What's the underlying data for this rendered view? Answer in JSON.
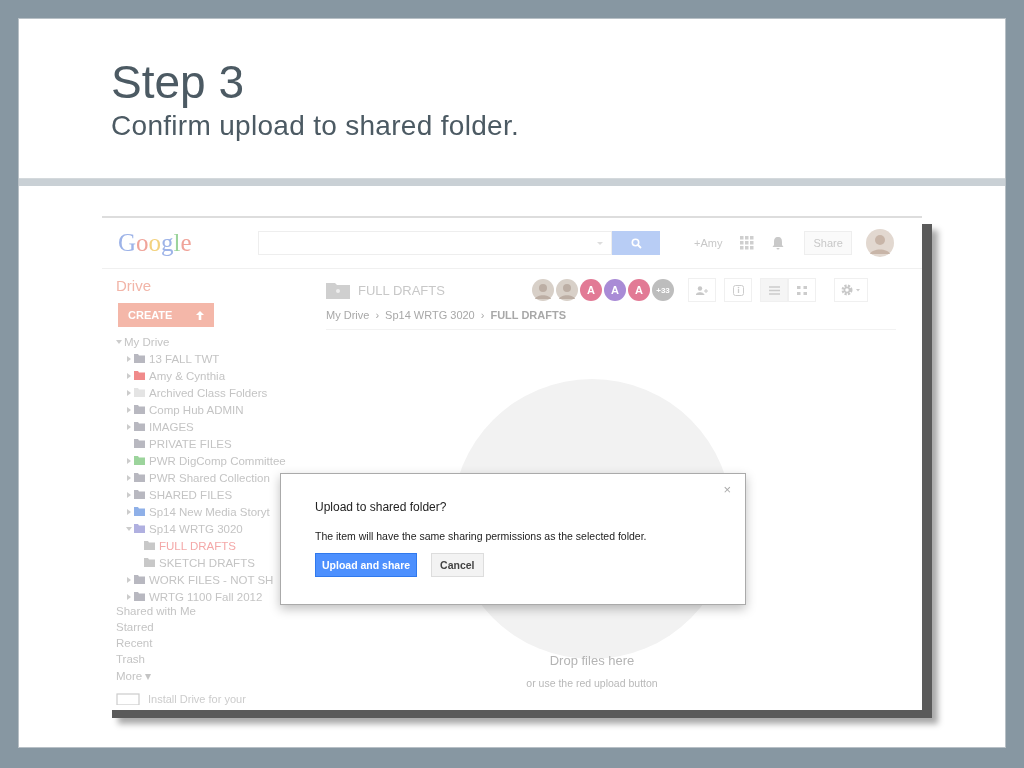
{
  "slide": {
    "title": "Step 3",
    "subtitle": "Confirm upload to shared folder."
  },
  "header": {
    "logo": "Google",
    "user": "+Amy",
    "share": "Share"
  },
  "drive_label": "Drive",
  "create_button": "CREATE",
  "folder_title": "FULL DRAFTS",
  "collaborators": [
    {
      "kind": "photo"
    },
    {
      "kind": "photo"
    },
    {
      "kind": "letter",
      "label": "A",
      "color": "#e27a95"
    },
    {
      "kind": "letter",
      "label": "A",
      "color": "#a98bd6"
    },
    {
      "kind": "letter",
      "label": "A",
      "color": "#e27a95"
    },
    {
      "kind": "count",
      "label": "+33"
    }
  ],
  "breadcrumb_separator": "›",
  "breadcrumb": [
    {
      "label": "My Drive",
      "current": false
    },
    {
      "label": "Sp14 WRTG 3020",
      "current": false
    },
    {
      "label": "FULL DRAFTS",
      "current": true
    }
  ],
  "tree": [
    {
      "label": "My Drive",
      "expanded": true,
      "children": [
        {
          "label": "13 FALL TWT",
          "expanded": false,
          "color": "#b8b8c0",
          "selected": false
        },
        {
          "label": "Amy & Cynthia",
          "expanded": false,
          "color": "#f08a8a",
          "selected": false
        },
        {
          "label": "Archived Class Folders",
          "expanded": false,
          "color": "#e4e4e4",
          "selected": false
        },
        {
          "label": "Comp Hub ADMIN",
          "expanded": false,
          "color": "#b8b8c0",
          "selected": false
        },
        {
          "label": "IMAGES",
          "expanded": false,
          "color": "#b8b8c0",
          "selected": false
        },
        {
          "label": "PRIVATE FILES",
          "color": "#b8b8c0",
          "selected": false
        },
        {
          "label": "PWR DigComp Committee",
          "expanded": false,
          "color": "#9cd49c",
          "selected": false
        },
        {
          "label": "PWR Shared Collection",
          "expanded": false,
          "color": "#b8b8c0",
          "selected": false
        },
        {
          "label": "SHARED FILES",
          "expanded": false,
          "color": "#b8b8c0",
          "selected": false
        },
        {
          "label": "Sp14 New Media Storyt",
          "expanded": false,
          "color": "#8fb0e8",
          "selected": false
        },
        {
          "label": "Sp14 WRTG 3020",
          "expanded": true,
          "color": "#b0b0e0",
          "selected": false,
          "children": [
            {
              "label": "FULL DRAFTS",
              "color": "#c8c8c8",
              "selected": true
            },
            {
              "label": "SKETCH DRAFTS",
              "color": "#c8c8c8",
              "selected": false
            }
          ]
        },
        {
          "label": "WORK FILES - NOT SH",
          "expanded": false,
          "color": "#b8b8c0",
          "selected": false
        },
        {
          "label": "WRTG 1100 Fall 2012",
          "expanded": false,
          "color": "#b8b8c0",
          "selected": false
        }
      ]
    }
  ],
  "nav": [
    "Shared with Me",
    "Starred",
    "Recent",
    "Trash",
    "More ▾"
  ],
  "install": "Install Drive for your",
  "dropzone": {
    "title": "Drop files here",
    "hint": "or use the red upload button"
  },
  "dialog": {
    "close": "×",
    "title": "Upload to shared folder?",
    "message": "The item will have the same sharing permissions as the selected folder.",
    "primary": "Upload and share",
    "secondary": "Cancel"
  }
}
